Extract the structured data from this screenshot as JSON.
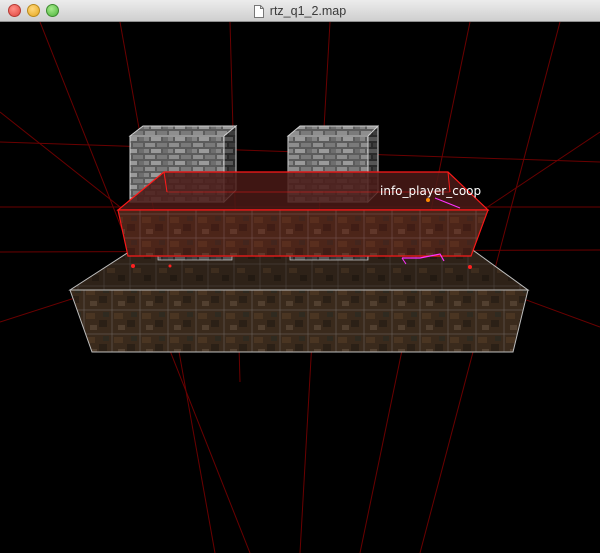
{
  "window": {
    "title": "rtz_q1_2.map"
  },
  "viewport": {
    "entity_label": "info_player_coop"
  },
  "colors": {
    "background": "#000000",
    "selection": "#ff1a1a",
    "entity_bounds": "#ff33ff",
    "grid_line": "#6a0000"
  }
}
